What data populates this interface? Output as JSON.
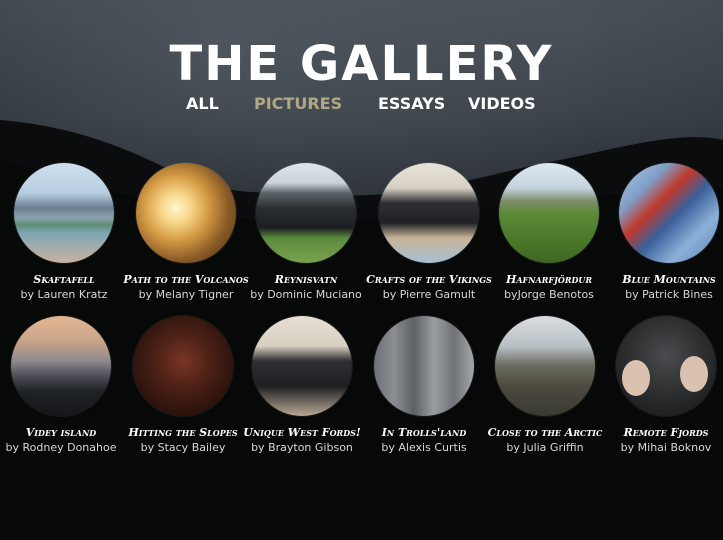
{
  "header": {
    "title": "THE GALLERY"
  },
  "nav": [
    {
      "label": "ALL",
      "active": false
    },
    {
      "label": "PICTURES",
      "active": true
    },
    {
      "label": "ESSAYS",
      "active": false
    },
    {
      "label": "VIDEOS",
      "active": false
    }
  ],
  "colors": {
    "active_nav": "#b3a685"
  },
  "gallery": [
    {
      "title": "Skaftafell",
      "author": "by Lauren Kratz"
    },
    {
      "title": "Path to the Volcanos",
      "author": "by Melany Tigner"
    },
    {
      "title": "Reynisvatn",
      "author": "by Dominic Muciano"
    },
    {
      "title": "Crafts of the Vikings",
      "author": "by Pierre Gamult"
    },
    {
      "title": "Hafnarfjördur",
      "author": "byJorge Benotos"
    },
    {
      "title": "Blue Mountains",
      "author": "by Patrick Bines"
    },
    {
      "title": "Videy island",
      "author": "by Rodney Donahoe"
    },
    {
      "title": "Hitting the Slopes",
      "author": "by Stacy Bailey"
    },
    {
      "title": "Unique West Fords!",
      "author": "by Brayton Gibson"
    },
    {
      "title": "In Trolls'land",
      "author": "by Alexis Curtis"
    },
    {
      "title": "Close to the Arctic",
      "author": "by Julia Griffin"
    },
    {
      "title": "Remote Fjords",
      "author": "by Mihai Boknov"
    }
  ]
}
